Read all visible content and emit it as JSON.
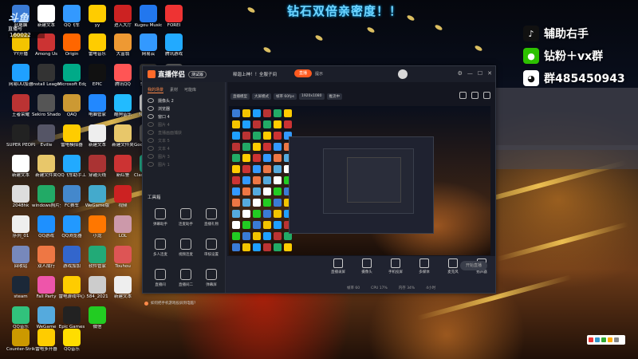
{
  "overlay": {
    "top_banner": "钻石双倍亲密度！！",
    "right_lines": [
      {
        "icon": "tiktok-icon",
        "text": "辅助右手"
      },
      {
        "icon": "wechat-icon",
        "text": "钻粉＋vx群"
      },
      {
        "icon": "qq-icon",
        "text": "群485450943"
      }
    ],
    "watermark": {
      "logo": "斗鱼",
      "sub": "直播号",
      "id": "160022"
    }
  },
  "desktop_icons": [
    {
      "label": "此电脑",
      "color": "#3a7bd5"
    },
    {
      "label": "YY开播",
      "color": "#f3c400"
    },
    {
      "label": "网易UU加速",
      "color": "#1fa0ff"
    },
    {
      "label": "王者荣耀",
      "color": "#b33"
    },
    {
      "label": "SUPER PEOPLE CBT",
      "color": "#222"
    },
    {
      "label": "新建文本",
      "color": "#fff"
    },
    {
      "label": "2048hk",
      "color": "#ddd"
    },
    {
      "label": "序列_01",
      "color": "#eee"
    },
    {
      "label": "回收站",
      "color": "#78b"
    },
    {
      "label": "steam",
      "color": "#1b2838"
    },
    {
      "label": "QQ音乐",
      "color": "#31c27c"
    },
    {
      "label": "Counter-Strike Global Off...",
      "color": "#c90"
    },
    {
      "label": "新建文本",
      "color": "#fff"
    },
    {
      "label": "Among Us",
      "color": "#c33"
    },
    {
      "label": "Install League o...",
      "color": "#333"
    },
    {
      "label": "Sekiro Shadow...",
      "color": "#555"
    },
    {
      "label": "Eville",
      "color": "#556"
    },
    {
      "label": "新建文件夹",
      "color": "#e8c76a"
    },
    {
      "label": "windows照片查看器",
      "color": "#2a6"
    },
    {
      "label": "QQ游戏",
      "color": "#1e90ff"
    },
    {
      "label": "双人成行",
      "color": "#e74"
    },
    {
      "label": "Fall Party",
      "color": "#e5a"
    },
    {
      "label": "WeGame",
      "color": "#5ad"
    },
    {
      "label": "雷电多开器",
      "color": "#fc0"
    },
    {
      "label": "QQ飞车",
      "color": "#39f"
    },
    {
      "label": "Origin",
      "color": "#f60"
    },
    {
      "label": "Microsoft Edge",
      "color": "#0a8"
    },
    {
      "label": "QAQ",
      "color": "#c93"
    },
    {
      "label": "雷电模拟器",
      "color": "#fc0"
    },
    {
      "label": "QQ飞车助手工具",
      "color": "#2af"
    },
    {
      "label": "FC赛车",
      "color": "#48c"
    },
    {
      "label": "QQ浏览器",
      "color": "#29f"
    },
    {
      "label": "游戏加加",
      "color": "#36c"
    },
    {
      "label": "雷电游戏中心",
      "color": "#fc0"
    },
    {
      "label": "Epic Games",
      "color": "#222"
    },
    {
      "label": "QQ音乐",
      "color": "#fd0"
    },
    {
      "label": "yy",
      "color": "#fc0"
    },
    {
      "label": "雷电音乐",
      "color": "#fc0"
    },
    {
      "label": "EPIC",
      "color": "#111"
    },
    {
      "label": "电脑管家",
      "color": "#28f"
    },
    {
      "label": "新建文本",
      "color": "#eee"
    },
    {
      "label": "穿越火线",
      "color": "#a33"
    },
    {
      "label": "WeGame版",
      "color": "#4ac"
    },
    {
      "label": "小龙",
      "color": "#f70"
    },
    {
      "label": "软件管家",
      "color": "#2a7"
    },
    {
      "label": "584_2021",
      "color": "#ccc"
    },
    {
      "label": "微信",
      "color": "#2c2"
    },
    {
      "label": "进入大厅",
      "color": "#c22"
    },
    {
      "label": "大富翁",
      "color": "#e93"
    },
    {
      "label": "腾讯QQ",
      "color": "#f55"
    },
    {
      "label": "酷狗音乐",
      "color": "#2bf"
    },
    {
      "label": "新建文件夹",
      "color": "#e8c76a"
    },
    {
      "label": "新红警",
      "color": "#c33"
    },
    {
      "label": "视频",
      "color": "#c22"
    },
    {
      "label": "LOL",
      "color": "#c9a"
    },
    {
      "label": "Touhou",
      "color": "#d55"
    },
    {
      "label": "新建文本",
      "color": "#eee"
    },
    {
      "label": "Kugou Music",
      "color": "#27e"
    },
    {
      "label": "网易云",
      "color": "#39f"
    },
    {
      "label": "SMOKE",
      "color": "#333"
    },
    {
      "label": "NAMBCE",
      "color": "#ddd"
    },
    {
      "label": "Google Chrome",
      "color": "#555"
    },
    {
      "label": "Clash for Windows",
      "color": "#2a8"
    },
    {
      "label": "FOREI",
      "color": "#e33"
    },
    {
      "label": "腾讯游戏",
      "color": "#2af"
    },
    {
      "label": "CS Steam",
      "color": "#666"
    }
  ],
  "app": {
    "logo_text": "直播伴侣",
    "beta": "测试版",
    "title": "释迦上神！！全服子间",
    "live_button": "直播",
    "prompt": "提示",
    "side_tabs": [
      "我的场景",
      "素材",
      "可能库"
    ],
    "scenes": [
      {
        "name": "摄像头 2",
        "dim": false
      },
      {
        "name": "浏览器",
        "dim": false
      },
      {
        "name": "窗口 4",
        "dim": false
      },
      {
        "name": "图片 4",
        "dim": true
      },
      {
        "name": "直播画面捕获",
        "dim": true
      },
      {
        "name": "文本 5",
        "dim": true
      },
      {
        "name": "文本 4",
        "dim": true
      },
      {
        "name": "图片 3",
        "dim": true
      },
      {
        "name": "图片 1",
        "dim": true
      }
    ],
    "tools_title": "工具箱",
    "tools": [
      "弹幕助手",
      "连麦助手",
      "直播礼物",
      "多人连麦",
      "视频连麦",
      "审核设置",
      "直播间",
      "直播间二",
      "弹幕屏"
    ],
    "tip": "如何把手机游戏投屏到电脑?",
    "preview_chips": [
      "直播模型",
      "大屏模式",
      "帧率 60fps",
      "1920x1080",
      "推流中"
    ],
    "bottom_tools": [
      "直播录屏",
      "摄像头",
      "手机投屏",
      "多媒体",
      "麦克风",
      "扬声器"
    ],
    "start_live": "开始直播",
    "status": [
      "帧率 60",
      "CPU 17%",
      "内存 34%",
      "4小时"
    ]
  },
  "colors": {
    "accent": "#ff6a2a",
    "overlay_blue": "#6fd5ff"
  }
}
